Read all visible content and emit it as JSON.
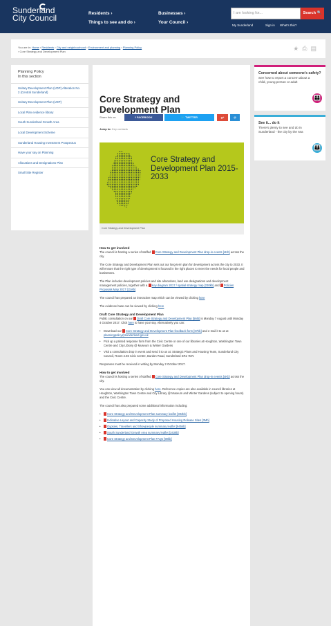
{
  "header": {
    "logo_line1": "Sunderland",
    "logo_line2": "City Council",
    "nav": [
      "Residents ›",
      "Businesses ›",
      "Things to see and do ›",
      "Your Council ›"
    ],
    "search_placeholder": "I am looking for...",
    "search_button": "Search",
    "links": [
      "My Sunderland",
      "Sign in",
      "What's this?"
    ]
  },
  "breadcrumb": {
    "prefix": "You are in:",
    "items": [
      "Home",
      "Residents",
      "City and neighbourhood",
      "Environment and planning",
      "Planning Policy"
    ],
    "current": "Core Strategy and Development Plan"
  },
  "sidebar": {
    "title_line1": "Planning Policy",
    "title_line2": "In this section",
    "items": [
      "Unitary Development Plan (UDP) Alteration No. 2 (Central Sunderland)",
      "Unitary Development Plan (UDP)",
      "Local Plan evidence library",
      "South Sunderland Growth Area",
      "Local Development Scheme",
      "Sunderland Housing Investment Prospectus",
      "Have your say on Planning",
      "Allocations and Designations Plan",
      "Small Site Register"
    ]
  },
  "main": {
    "title": "Core Strategy and Development Plan",
    "share_label": "Share this on",
    "share": {
      "facebook": "FACEBOOK",
      "twitter": "TWITTER",
      "gplus": "g+",
      "email": "@"
    },
    "jump_label": "Jump to:",
    "jump_link": "Key contacts",
    "hero_text": "Core Strategy and Development Plan 2015-2033",
    "hero_caption": "Core Strategy and Development Plan",
    "s1_heading": "How to get involved",
    "s1_p1a": "The council is hosting a series of staffed ",
    "s1_p1_link": "Core Strategy and Development Plan drop-in events [4Kb]",
    "s1_p1b": " across the city.",
    "p2": "The Core Strategy and Development Plan sets out our long-term plan for development across the city to 2033. It will ensure that the right type of development is focused in the right places to meet the needs for local people and businesses.",
    "p3a": "The Plan includes development policies and site allocations, land use designations and development management policies, together with a ",
    "p3_link1": "Key diagram 2017 / spatial strategy map [230kb]",
    "p3b": " and ",
    "p3_link2": "Policies Proposals Map 2017 [11Mb]",
    "p4a": "The council has prepared an interactive map which can be viewed by clicking ",
    "p4_link": "here",
    "p5a": "The evidence base can be viewed by clicking ",
    "p5_link": "here",
    "s2_heading": "Draft Core Strategy and Development Plan",
    "s2_p1a": "Public consultation on our ",
    "s2_p1_link": "Draft Core Strategy and Development Plan [5Mb]",
    "s2_p1b": " is Monday 7 August until Monday 4 October 2017. Click ",
    "s2_p1_link2": "here",
    "s2_p1c": " to have your say. Alternatively you can:",
    "bullet1a": "Download our ",
    "bullet1_link": "Core Strategy and Development Plan feedback form [87kb]",
    "bullet1b": " and e-mail it to us at ",
    "bullet1_link2": "planningpolicy@sunderland.gov.uk",
    "bullet2": "Pick up a printed response form from the Civic Centre or one of our libraries at Houghton, Washington Town Centre and City Library @ Museum & Winter Gardens",
    "bullet3": "Visit a consultation drop in event and send it to us at: Strategic Plans and Housing Team, Sunderland City Council, Room 2.66 Civic Centre, Burdon Road, Sunderland SR2 7DN",
    "responses": "Responses must be received in writing by Monday 2 October 2017.",
    "s3_heading": "How to get involved",
    "s3_p1a": "The council is hosting a series of staffed ",
    "s3_p1_link": "Core Strategy and Development Plan drop-in events [4Kb]",
    "s3_p1b": " across the city.",
    "p6a": "You can view all documentation by clicking ",
    "p6_link": "here",
    "p6b": ". Reference copies are also available in council libraries at Houghton, Washington Town Centre and City Library @ Museum and Winter Gardens (subject to opening hours) and the Civic Centre.",
    "p7": "The council has also prepared some additional information including:",
    "doc_links": [
      "Core Strategy and Development Plan summary leaflet [302kb]",
      "Indicative Layout and Capacity Study of Proposed Housing Release Sites [3Mb]",
      "Gypsies, Travellers and Showpeople summary leaflet [945kb]",
      "South Sunderland Growth Area summary leaflet [343kb]",
      "Core Strategy and Development Plan FAQs [90kb]"
    ]
  },
  "panels": [
    {
      "heading": "Concerned about someone's safety?",
      "text": "See how to report a concern about a child, young person or adult",
      "accent": "#d01f7a"
    },
    {
      "heading": "See it... do it",
      "text": "There's plenty to see and do in Sunderland - the city by the sea",
      "accent": "#3aaed8"
    }
  ],
  "colors": {
    "header": "#19355f",
    "search": "#d9342b",
    "hero": "#b5c81c",
    "link": "#1a5a9e"
  }
}
